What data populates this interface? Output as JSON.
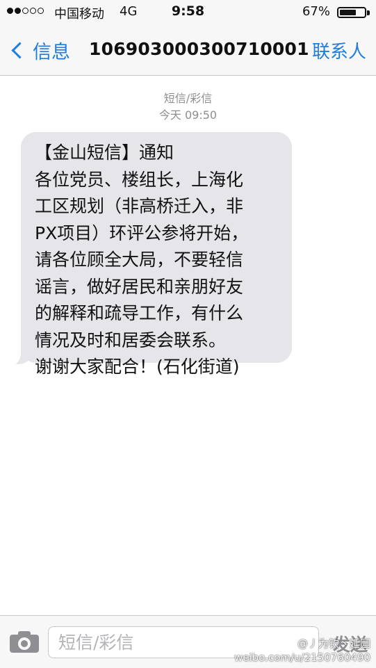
{
  "status_bar": {
    "signal_bars_filled": 2,
    "signal_bars_total": 5,
    "carrier": "中国移动",
    "network": "4G",
    "time": "9:58",
    "battery_percent": "67%",
    "battery_level": 0.67
  },
  "nav": {
    "back_label": "信息",
    "title": "10690300030071000​1",
    "contacts_label": "联系人"
  },
  "conversation": {
    "meta_type": "短信/彩信",
    "meta_time": "今天 09:50"
  },
  "message": {
    "lines": [
      "【金山短信】通知",
      "各位党员、楼组长，上海化",
      "工区规划（非高桥迁入，非",
      "PX项目）环评公参将开始，",
      "请各位顾全大局，不要轻信",
      "谣言，做好居民和亲朋好友",
      "的解释和疏导工作，有什么",
      "情况及时和居委会联系。",
      "谢谢大家配合！(石化街道)"
    ]
  },
  "input_bar": {
    "placeholder": "短信/彩信",
    "send_label": "发送"
  },
  "watermark": {
    "line1": "@丿为钦丶延园",
    "line2": "weibo.com/u/2150760490"
  },
  "colors": {
    "accent": "#1f7de0",
    "bubble": "#e5e5ea",
    "bar_background": "#f7f7f7",
    "meta_text": "#8e8e93"
  },
  "icons": {
    "back": "chevron-left-icon",
    "camera": "camera-icon",
    "battery": "battery-icon",
    "signal": "signal-dots-icon"
  }
}
